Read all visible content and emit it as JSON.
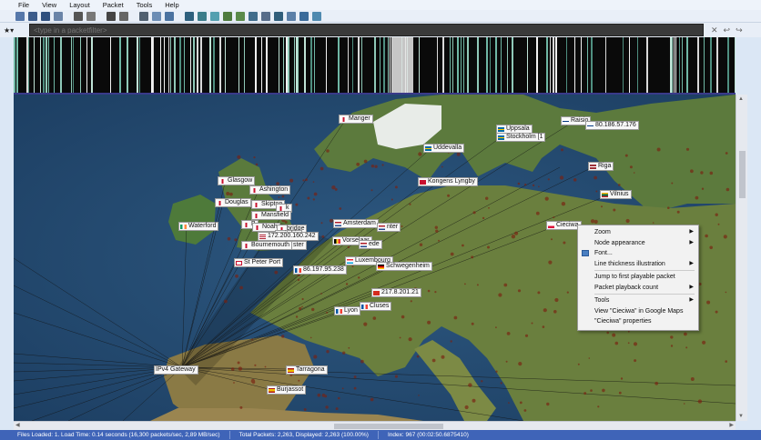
{
  "menu": [
    "File",
    "View",
    "Layout",
    "Packet",
    "Tools",
    "Help"
  ],
  "filter": {
    "star": "★▾",
    "placeholder": "<type in a packetfilter>",
    "close": "✕",
    "undo": "↩",
    "redo": "↪"
  },
  "toolbar_icons": [
    "open-icon",
    "save-icon",
    "save-as-icon",
    "print-icon",
    "settings-icon",
    "layout-icon",
    "camera-icon",
    "grid-icon",
    "map-icon",
    "node-icon",
    "chart-icon",
    "graph-icon",
    "bar-icon",
    "list-icon",
    "timeline-icon"
  ],
  "map_nodes": [
    {
      "id": "manger",
      "label": "Manger",
      "flag": "gb"
    },
    {
      "id": "uppsala",
      "label": "Uppsala",
      "flag": "se"
    },
    {
      "id": "stockholm",
      "label": "Stockholm [1",
      "flag": "se"
    },
    {
      "id": "raisio",
      "label": "Raisio",
      "flag": "fi"
    },
    {
      "id": "ip-80",
      "label": "80.186.57.176",
      "flag": "fi"
    },
    {
      "id": "uddevalla",
      "label": "Uddevalla",
      "flag": "se"
    },
    {
      "id": "kongens-lyngby",
      "label": "Kongens Lyngby",
      "flag": "dk"
    },
    {
      "id": "riga",
      "label": "Riga",
      "flag": "lv"
    },
    {
      "id": "vilnius",
      "label": "Vilnius",
      "flag": "lt"
    },
    {
      "id": "glasgow",
      "label": "Glasgow",
      "flag": "gb"
    },
    {
      "id": "ashington",
      "label": "Ashington",
      "flag": "gb"
    },
    {
      "id": "douglas",
      "label": "Douglas",
      "flag": "gb"
    },
    {
      "id": "skipton",
      "label": "Skipton",
      "flag": "gb"
    },
    {
      "id": "k",
      "label": "k",
      "flag": "gb"
    },
    {
      "id": "mansfield",
      "label": "Mansfield",
      "flag": "gb"
    },
    {
      "id": "waterford",
      "label": "Waterford",
      "flag": "ie"
    },
    {
      "id": "b",
      "label": "B",
      "flag": "gb"
    },
    {
      "id": "noah",
      "label": "Noah",
      "flag": "gb"
    },
    {
      "id": "cambridge",
      "label": "bridge",
      "flag": "gb"
    },
    {
      "id": "mitchin",
      "label": "itchin",
      "flag": "gb"
    },
    {
      "id": "ip-172",
      "label": "172.200.160.242",
      "flag": "us"
    },
    {
      "id": "ster",
      "label": "ster",
      "flag": "gb"
    },
    {
      "id": "bournemouth",
      "label": "Bournemouth",
      "flag": "gb"
    },
    {
      "id": "amsterdam",
      "label": "Amsterdam",
      "flag": "nl"
    },
    {
      "id": "nter",
      "label": "nter",
      "flag": "nl"
    },
    {
      "id": "vorselaar",
      "label": "Vorselaar",
      "flag": "be"
    },
    {
      "id": "ede",
      "label": "ede",
      "flag": "nl"
    },
    {
      "id": "st-peter-port",
      "label": "St Peter Port",
      "flag": "je"
    },
    {
      "id": "luxembourg",
      "label": "Luxembourg",
      "flag": "lu"
    },
    {
      "id": "schwegenheim",
      "label": "Schwegenheim",
      "flag": "de"
    },
    {
      "id": "ip-86",
      "label": "86.197.95.238",
      "flag": "fr"
    },
    {
      "id": "cieciwa",
      "label": "Cieciwa",
      "flag": "pl"
    },
    {
      "id": "ip-217",
      "label": "217.8.201.21",
      "flag": "ch"
    },
    {
      "id": "lyon",
      "label": "Lyon",
      "flag": "fr"
    },
    {
      "id": "cluses",
      "label": "Cluses",
      "flag": "fr"
    },
    {
      "id": "ipv4-gateway",
      "label": "IPv4 Gateway",
      "flag": ""
    },
    {
      "id": "tarragona",
      "label": "Tarragona",
      "flag": "es"
    },
    {
      "id": "burjassot",
      "label": "Burjassot",
      "flag": "es"
    }
  ],
  "context_menu": {
    "zoom": "Zoom",
    "node_appearance": "Node appearance",
    "font": "Font...",
    "line_thickness": "Line thickness illustration",
    "jump_first": "Jump to first playable packet",
    "playback_count": "Packet playback count",
    "tools": "Tools",
    "google_maps": "View \"Cieciwa\" in Google Maps",
    "properties": "\"Cieciwa\" properties"
  },
  "status": {
    "files": "Files Loaded: 1. Load Time: 0.14 seconds (16,300 packets/sec, 2,89 MB/sec)",
    "packets": "Total Packets: 2,263, Displayed: 2,263 (100.00%)",
    "index": "Index: 967 (00:02:50.6875410)"
  },
  "colors": {
    "status_bg": "#3f64b8",
    "map_sea": "#254a70",
    "land": "#5d7a3e",
    "timeline_bg": "#0a0a0a"
  }
}
